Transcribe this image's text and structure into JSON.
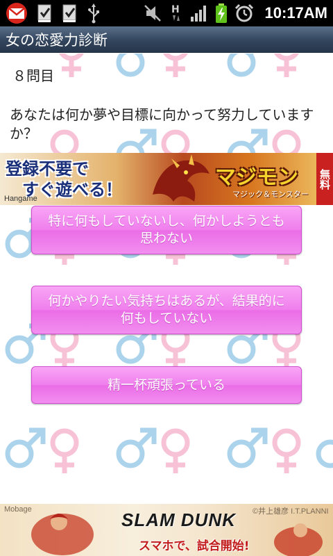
{
  "status_bar": {
    "time": "10:17AM",
    "left_icons": [
      "gmail-icon",
      "task-check-icon",
      "task-check-icon",
      "usb-icon"
    ],
    "right_icons": [
      "vibrate-mute-icon",
      "data-h-icon",
      "signal-icon",
      "battery-charging-icon",
      "alarm-icon"
    ]
  },
  "title_bar": {
    "title": "女の恋愛力診断"
  },
  "quiz": {
    "question_number": "８問目",
    "question": "あなたは何か夢や目標に向かって努力していますか？",
    "answers": [
      "特に何もしていないし、何かしようとも思わない",
      "何かやりたい気持ちはあるが、結果的に何もしていない",
      "精一杯頑張っている"
    ]
  },
  "ad_top": {
    "text_line1": "登録不要で",
    "text_line2": "すぐ遊べる！",
    "brand": "Hangame",
    "game_title": "マジモン",
    "game_subtitle": "マジック＆モンスター",
    "badge": "無料"
  },
  "ad_bottom": {
    "brand": "Mobage",
    "logo": "SLAM DUNK",
    "tagline": "スマホで、試合開始!",
    "copyright": "©井上雄彦 I.T.PLANNING,INC. ©TOEI ANIMATION ©II/TP/T"
  },
  "colors": {
    "male_symbol": "#7ab8e0",
    "female_symbol": "#f5a3c3",
    "button_pink": "#ef7eec",
    "title_bar": "#33455d"
  }
}
